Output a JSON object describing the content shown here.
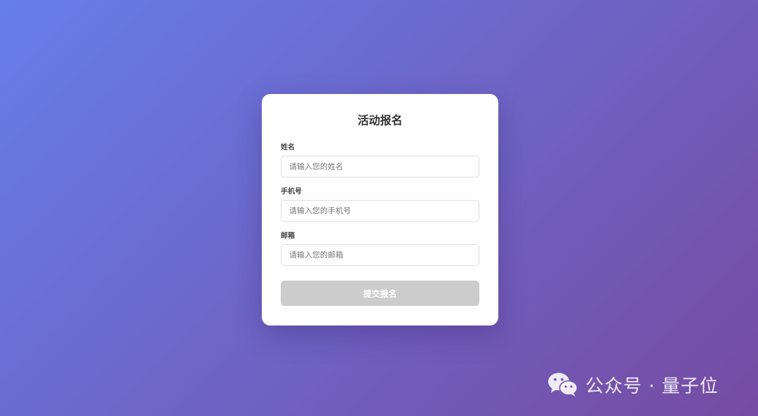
{
  "form": {
    "title": "活动报名",
    "fields": [
      {
        "label": "姓名",
        "placeholder": "请输入您的姓名",
        "value": ""
      },
      {
        "label": "手机号",
        "placeholder": "请输入您的手机号",
        "value": ""
      },
      {
        "label": "邮箱",
        "placeholder": "请输入您的邮箱",
        "value": ""
      }
    ],
    "submit_label": "提交报名"
  },
  "watermark": {
    "icon": "wechat-icon",
    "text": "公众号 · 量子位"
  },
  "colors": {
    "background_gradient_start": "#667eea",
    "background_gradient_end": "#764ba2",
    "card": "#ffffff",
    "button_disabled": "#cccccc"
  }
}
